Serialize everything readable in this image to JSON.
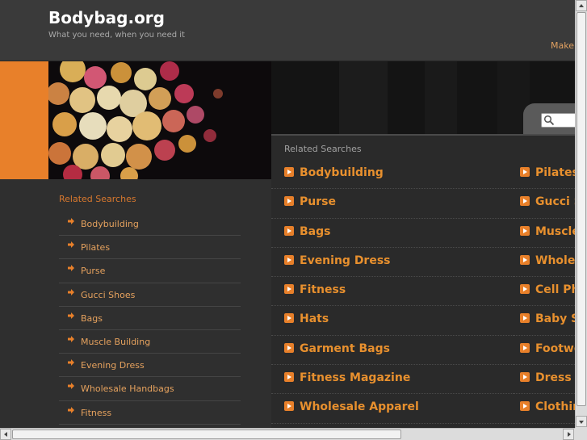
{
  "header": {
    "site_title": "Bodybag.org",
    "tagline": "What you need, when you need it",
    "make_link": "Make"
  },
  "colors": {
    "accent_orange": "#e8802a",
    "link_orange": "#e8902e",
    "background": "#2f2f2f",
    "header_bg": "#3a3a3a"
  },
  "sidebar": {
    "heading": "Related Searches",
    "items": [
      {
        "label": "Bodybuilding"
      },
      {
        "label": "Pilates"
      },
      {
        "label": "Purse"
      },
      {
        "label": "Gucci Shoes"
      },
      {
        "label": "Bags"
      },
      {
        "label": "Muscle Building"
      },
      {
        "label": "Evening Dress"
      },
      {
        "label": "Wholesale Handbags"
      },
      {
        "label": "Fitness"
      }
    ]
  },
  "main": {
    "heading": "Related Searches",
    "left_column": [
      {
        "label": "Bodybuilding"
      },
      {
        "label": "Purse"
      },
      {
        "label": "Bags"
      },
      {
        "label": "Evening Dress"
      },
      {
        "label": "Fitness"
      },
      {
        "label": "Hats"
      },
      {
        "label": "Garment Bags"
      },
      {
        "label": "Fitness Magazine"
      },
      {
        "label": "Wholesale Apparel"
      }
    ],
    "right_column": [
      {
        "label": "Pilates"
      },
      {
        "label": "Gucci S"
      },
      {
        "label": "Muscle"
      },
      {
        "label": "Wholes"
      },
      {
        "label": "Cell Ph"
      },
      {
        "label": "Baby S"
      },
      {
        "label": "Footwe"
      },
      {
        "label": "Dress S"
      },
      {
        "label": "Clothin"
      }
    ]
  },
  "icons": {
    "search": "search-icon",
    "list_arrow": "arrow-right-icon",
    "bullet": "orange-arrow-bullet-icon"
  }
}
